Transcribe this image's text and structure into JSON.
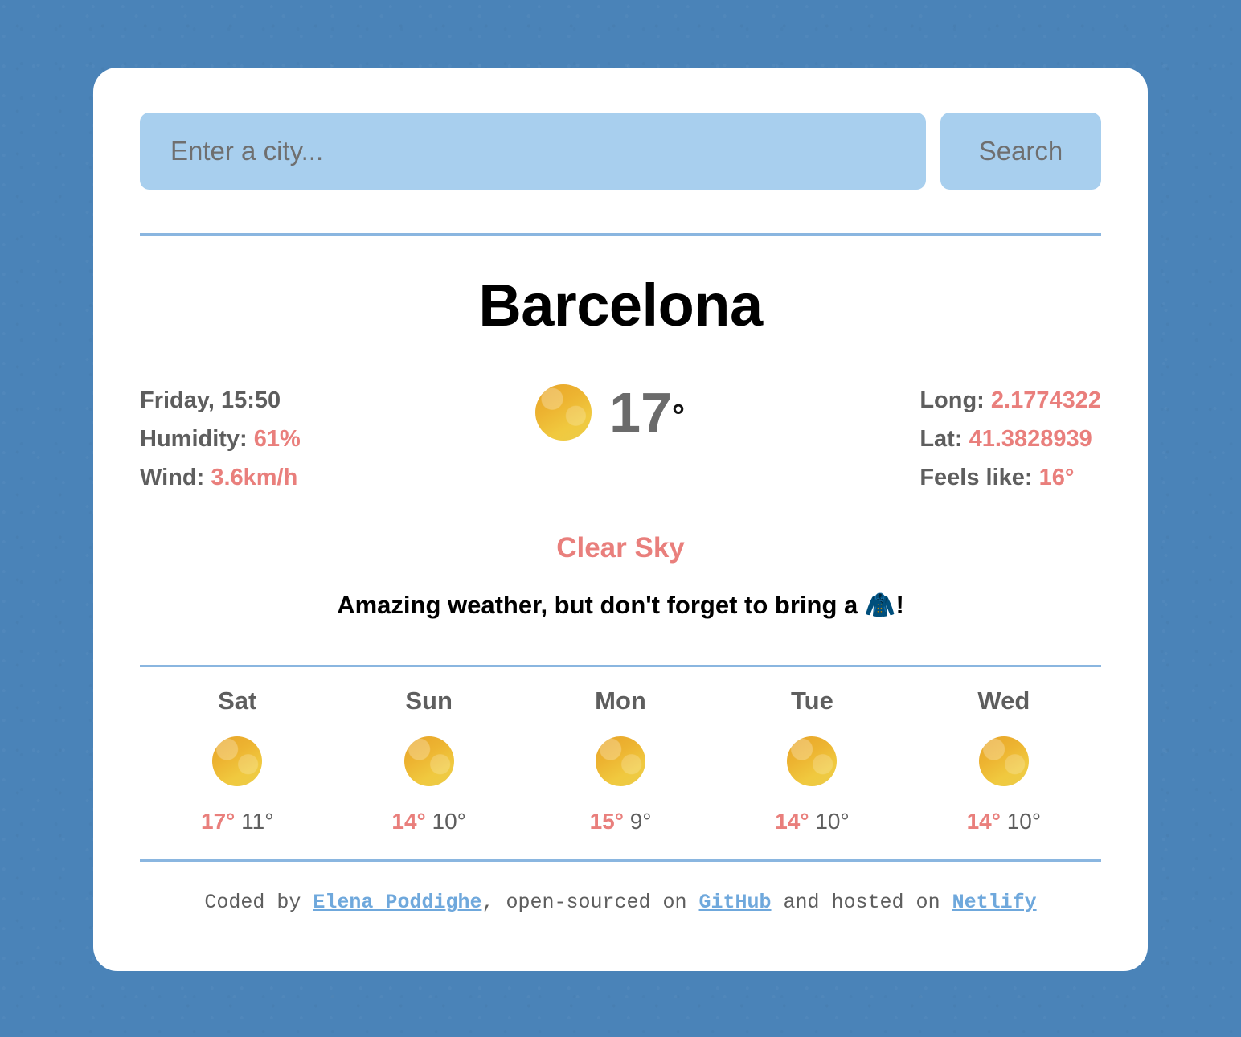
{
  "search": {
    "placeholder": "Enter a city...",
    "value": "",
    "button_label": "Search"
  },
  "current": {
    "city": "Barcelona",
    "datetime": "Friday, 15:50",
    "humidity_label": "Humidity:",
    "humidity_value": "61%",
    "wind_label": "Wind:",
    "wind_value": "3.6km/h",
    "long_label": "Long:",
    "long_value": "2.1774322",
    "lat_label": "Lat:",
    "lat_value": "41.3828939",
    "feels_like_label": "Feels like:",
    "feels_like_value": "16°",
    "temperature": "17",
    "temperature_unit": "°",
    "icon": "sun-icon",
    "condition": "Clear Sky",
    "message": "Amazing weather, but don't forget to bring a 🧥!"
  },
  "forecast": [
    {
      "day": "Sat",
      "icon": "sun-icon",
      "max": "17°",
      "min": "11°"
    },
    {
      "day": "Sun",
      "icon": "sun-icon",
      "max": "14°",
      "min": "10°"
    },
    {
      "day": "Mon",
      "icon": "sun-icon",
      "max": "15°",
      "min": "9°"
    },
    {
      "day": "Tue",
      "icon": "sun-icon",
      "max": "14°",
      "min": "10°"
    },
    {
      "day": "Wed",
      "icon": "sun-icon",
      "max": "14°",
      "min": "10°"
    }
  ],
  "footer": {
    "prefix": "Coded by ",
    "author": "Elena Poddighe",
    "middle": ", open-sourced on ",
    "repo": "GitHub",
    "middle2": " and hosted on ",
    "host": "Netlify"
  },
  "colors": {
    "page_background": "#4a83b8",
    "card_background": "#ffffff",
    "accent": "#e97f7c",
    "control_background": "#a8cfee",
    "divider": "#8ab6e0",
    "link": "#6fa8dc",
    "muted_text": "#5e5e5e"
  }
}
